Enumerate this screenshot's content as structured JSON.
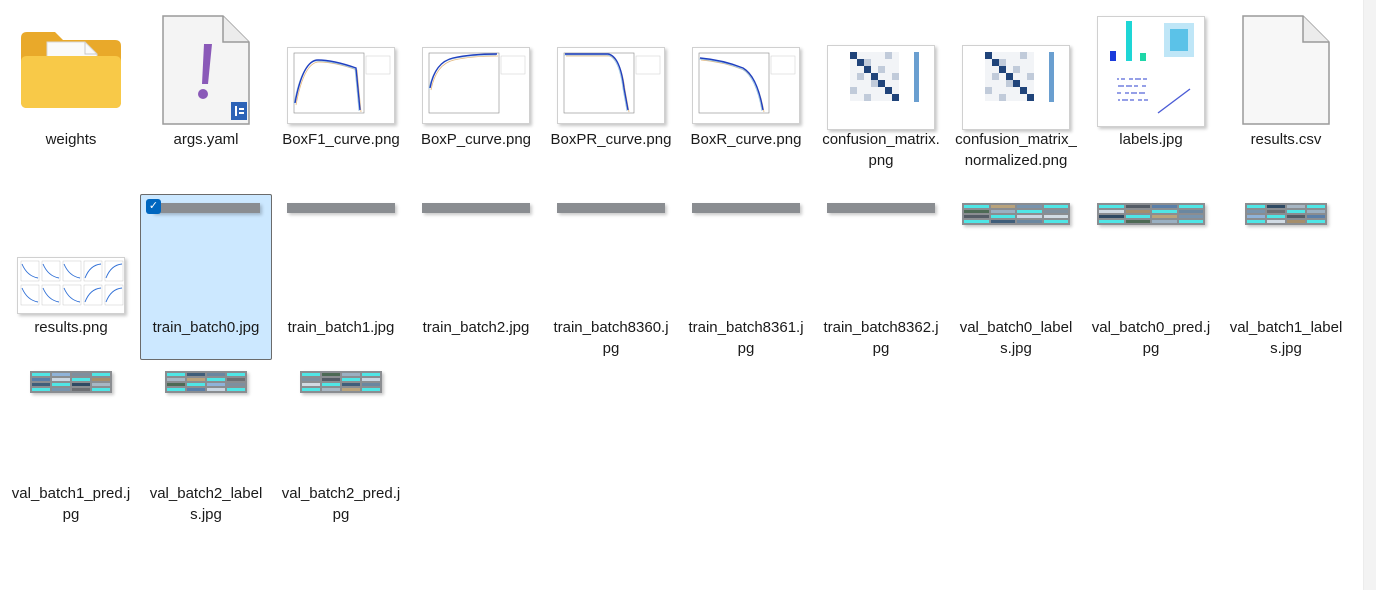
{
  "files": [
    {
      "name": "weights",
      "type": "folder"
    },
    {
      "name": "args.yaml",
      "type": "yaml"
    },
    {
      "name": "BoxF1_curve.png",
      "type": "curve"
    },
    {
      "name": "BoxP_curve.png",
      "type": "curve"
    },
    {
      "name": "BoxPR_curve.png",
      "type": "curve"
    },
    {
      "name": "BoxR_curve.png",
      "type": "curve"
    },
    {
      "name": "confusion_matrix.png",
      "type": "matrix"
    },
    {
      "name": "confusion_matrix_normalized.png",
      "type": "matrix"
    },
    {
      "name": "labels.jpg",
      "type": "labels"
    },
    {
      "name": "results.csv",
      "type": "blank"
    },
    {
      "name": "results.png",
      "type": "results"
    },
    {
      "name": "train_batch0.jpg",
      "type": "mosaic",
      "selected": true
    },
    {
      "name": "train_batch1.jpg",
      "type": "mosaic"
    },
    {
      "name": "train_batch2.jpg",
      "type": "mosaic"
    },
    {
      "name": "train_batch8360.jpg",
      "type": "mosaic"
    },
    {
      "name": "train_batch8361.jpg",
      "type": "mosaic"
    },
    {
      "name": "train_batch8362.jpg",
      "type": "mosaic"
    },
    {
      "name": "val_batch0_labels.jpg",
      "type": "valwide"
    },
    {
      "name": "val_batch0_pred.jpg",
      "type": "valwide"
    },
    {
      "name": "val_batch1_labels.jpg",
      "type": "valtall"
    },
    {
      "name": "val_batch1_pred.jpg",
      "type": "valtall"
    },
    {
      "name": "val_batch2_labels.jpg",
      "type": "valtall"
    },
    {
      "name": "val_batch2_pred.jpg",
      "type": "valtall"
    }
  ],
  "icons": {
    "folder": "folder-icon",
    "yaml": "yaml-file-icon",
    "blank": "generic-file-icon",
    "thumbnail": "image-thumbnail"
  },
  "colors": {
    "selection_bg": "#cce8ff",
    "check_blue": "#0067c0",
    "folder_yellow": "#f8c948",
    "yaml_purple": "#8a59b8"
  }
}
